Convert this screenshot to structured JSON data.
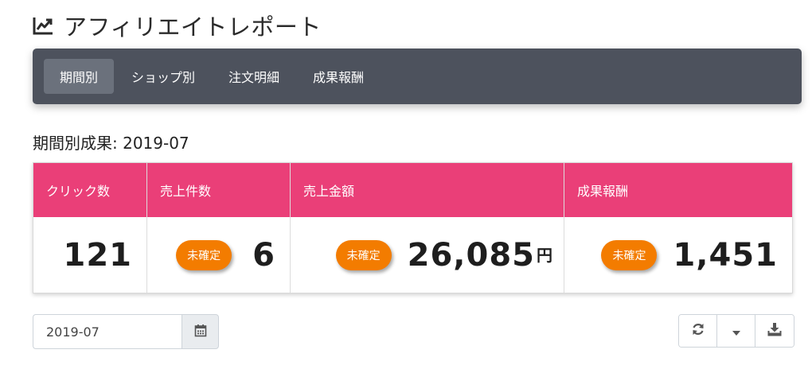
{
  "header": {
    "title": "アフィリエイトレポート",
    "icon": "chart-line-icon"
  },
  "tabs": [
    {
      "label": "期間別",
      "active": true
    },
    {
      "label": "ショップ別",
      "active": false
    },
    {
      "label": "注文明細",
      "active": false
    },
    {
      "label": "成果報酬",
      "active": false
    }
  ],
  "section": {
    "title": "期間別成果: 2019-07"
  },
  "summary": {
    "clicks": {
      "label": "クリック数",
      "value": "121"
    },
    "sales_count": {
      "label": "売上件数",
      "badge": "未確定",
      "value": "6"
    },
    "sales_amount": {
      "label": "売上金額",
      "badge": "未確定",
      "value": "26,085",
      "unit": "円"
    },
    "reward": {
      "label": "成果報酬",
      "badge": "未確定",
      "value": "1,451"
    }
  },
  "date_filter": {
    "value": "2019-07",
    "calendar_icon": "calendar-icon"
  },
  "toolbar": {
    "refresh_icon": "refresh-icon",
    "dropdown_icon": "caret-down-icon",
    "download_icon": "download-icon"
  },
  "colors": {
    "accent": "#ea3f78",
    "badge": "#f37c00",
    "tabbar": "#4d525d"
  }
}
